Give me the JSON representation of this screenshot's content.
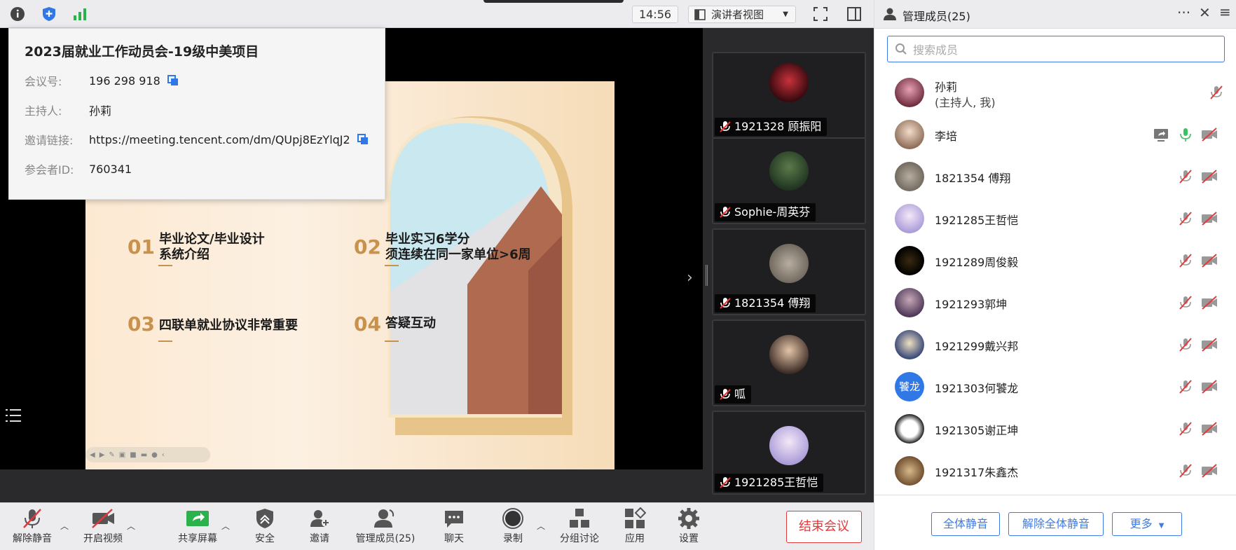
{
  "topbar": {
    "icons": [
      "info-icon",
      "security-shield-icon",
      "signal-icon"
    ],
    "clock": "14:56",
    "view_mode": "演讲者视图"
  },
  "meeting_info": {
    "title": "2023届就业工作动员会-19级中美项目",
    "rows": [
      {
        "key": "会议号:",
        "value": "196 298 918"
      },
      {
        "key": "主持人:",
        "value": "孙莉"
      },
      {
        "key": "邀请链接:",
        "value": "https://meeting.tencent.com/dm/QUpj8EzYlqJ2"
      },
      {
        "key": "参会者ID:",
        "value": "760341"
      }
    ]
  },
  "slide": {
    "items": [
      {
        "num": "01",
        "text": "毕业论文/毕业设计\n系统介绍"
      },
      {
        "num": "02",
        "text": "毕业实习6学分\n须连续在同一家单位>6周"
      },
      {
        "num": "03",
        "text": "四联单就业协议非常重要"
      },
      {
        "num": "04",
        "text": "答疑互动"
      }
    ]
  },
  "video_tiles": [
    {
      "name": "1921328 顾振阳"
    },
    {
      "name": "Sophie-周英芬"
    },
    {
      "name": "1821354 傅翔"
    },
    {
      "name": "呱"
    },
    {
      "name": "1921285王哲恺"
    }
  ],
  "toolbar": {
    "unmute": "解除静音",
    "start_video": "开启视频",
    "share_screen": "共享屏幕",
    "security": "安全",
    "invite": "邀请",
    "manage_members": "管理成员(25)",
    "chat": "聊天",
    "record": "录制",
    "breakout": "分组讨论",
    "apps": "应用",
    "settings": "设置",
    "end_meeting": "结束会议"
  },
  "panel": {
    "title": "管理成员(25)",
    "search_placeholder": "搜索成员",
    "members": [
      {
        "name": "孙莉",
        "sub": "(主持人, 我)"
      },
      {
        "name": "李培"
      },
      {
        "name": "1821354 傅翔"
      },
      {
        "name": "1921285王哲恺"
      },
      {
        "name": "1921289周俊毅"
      },
      {
        "name": "1921293郭坤"
      },
      {
        "name": "1921299戴兴邦"
      },
      {
        "name": "1921303何饕龙",
        "avatar_text": "饕龙"
      },
      {
        "name": "1921305谢正坤"
      },
      {
        "name": "1921317朱鑫杰"
      }
    ],
    "footer": {
      "mute_all": "全体静音",
      "unmute_all": "解除全体静音",
      "more": "更多"
    }
  },
  "colors": {
    "accent": "#3d7be6",
    "danger": "#e03a3a",
    "mic_on": "#3cc160",
    "slide_number": "#c8914c"
  }
}
